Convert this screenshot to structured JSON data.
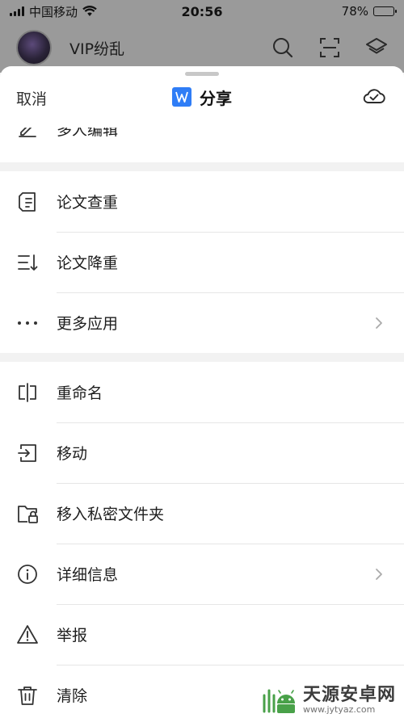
{
  "status_bar": {
    "carrier": "中国移动",
    "time": "20:56",
    "battery": "78%",
    "battery_level": 0.78
  },
  "app_header": {
    "user_name": "VIP纷乱",
    "icons": [
      "search-icon",
      "scan-icon",
      "layers-icon"
    ]
  },
  "sheet": {
    "cancel_label": "取消",
    "title": "分享",
    "title_icon": "doc-badge-icon",
    "right_icon": "cloud-check-icon"
  },
  "menu_groups": [
    {
      "items": [
        {
          "label": "多人编辑",
          "icon": "edit-icon",
          "chevron": false
        }
      ]
    },
    {
      "items": [
        {
          "label": "论文查重",
          "icon": "paper-check-icon",
          "chevron": false
        },
        {
          "label": "论文降重",
          "icon": "list-sort-icon",
          "chevron": false
        },
        {
          "label": "更多应用",
          "icon": "more-dots-icon",
          "chevron": true
        }
      ]
    },
    {
      "items": [
        {
          "label": "重命名",
          "icon": "rename-icon",
          "chevron": false
        },
        {
          "label": "移动",
          "icon": "move-icon",
          "chevron": false
        },
        {
          "label": "移入私密文件夹",
          "icon": "private-folder-icon",
          "chevron": false
        },
        {
          "label": "详细信息",
          "icon": "info-icon",
          "chevron": true
        },
        {
          "label": "举报",
          "icon": "warning-icon",
          "chevron": false
        },
        {
          "label": "清除",
          "icon": "trash-icon",
          "chevron": false
        }
      ]
    }
  ],
  "watermark": {
    "text": "天源安卓网",
    "url": "www.jytyaz.com",
    "logo_icon": "android-logo-icon"
  },
  "colors": {
    "accent": "#2f7df6",
    "overlay": "#9a9a9a",
    "divider": "#e6e6e6",
    "background": "#f2f2f2"
  }
}
